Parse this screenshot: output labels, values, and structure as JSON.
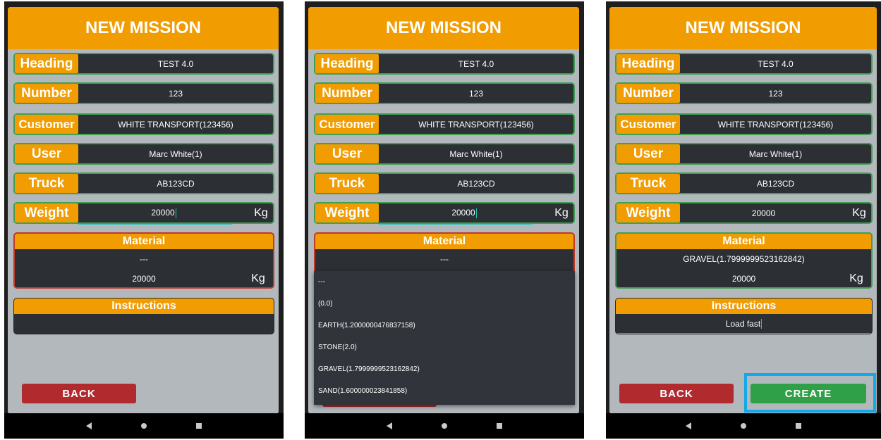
{
  "screens": [
    {
      "title": "NEW MISSION",
      "fields": [
        {
          "label": "Heading",
          "value": "TEST 4.0"
        },
        {
          "label": "Number",
          "value": "123"
        },
        {
          "label": "Customer",
          "value": "WHITE TRANSPORT(123456)"
        },
        {
          "label": "User",
          "value": "Marc White(1)"
        },
        {
          "label": "Truck",
          "value": "AB123CD"
        },
        {
          "label": "Weight",
          "value": "20000",
          "unit": "Kg"
        }
      ],
      "material": {
        "header": "Material",
        "selected": "---",
        "weight": "20000",
        "unit": "Kg"
      },
      "instructions": {
        "header": "Instructions",
        "value": ""
      },
      "back_label": "BACK"
    },
    {
      "title": "NEW MISSION",
      "fields": [
        {
          "label": "Heading",
          "value": "TEST 4.0"
        },
        {
          "label": "Number",
          "value": "123"
        },
        {
          "label": "Customer",
          "value": "WHITE TRANSPORT(123456)"
        },
        {
          "label": "User",
          "value": "Marc White(1)"
        },
        {
          "label": "Truck",
          "value": "AB123CD"
        },
        {
          "label": "Weight",
          "value": "20000",
          "unit": "Kg"
        }
      ],
      "material": {
        "header": "Material",
        "selected": "---"
      },
      "dropdown_options": [
        "---",
        "(0.0)",
        "EARTH(1.2000000476837158)",
        "STONE(2.0)",
        "GRAVEL(1.7999999523162842)",
        "SAND(1.600000023841858)"
      ]
    },
    {
      "title": "NEW MISSION",
      "fields": [
        {
          "label": "Heading",
          "value": "TEST 4.0"
        },
        {
          "label": "Number",
          "value": "123"
        },
        {
          "label": "Customer",
          "value": "WHITE TRANSPORT(123456)"
        },
        {
          "label": "User",
          "value": "Marc White(1)"
        },
        {
          "label": "Truck",
          "value": "AB123CD"
        },
        {
          "label": "Weight",
          "value": "20000",
          "unit": "Kg"
        }
      ],
      "material": {
        "header": "Material",
        "selected": "GRAVEL(1.7999999523162842)",
        "weight": "20000",
        "unit": "Kg"
      },
      "instructions": {
        "header": "Instructions",
        "value": "Load fast"
      },
      "back_label": "BACK",
      "create_label": "CREATE"
    }
  ],
  "icons": {
    "nav": [
      "back-triangle",
      "home-circle",
      "recents-square"
    ]
  },
  "colors": {
    "accent": "#f19c00",
    "field_border": "#3f9f52",
    "material_error_border": "#c0392b",
    "back": "#b02a2e",
    "create": "#2fa048",
    "highlight": "#12a9e6"
  }
}
